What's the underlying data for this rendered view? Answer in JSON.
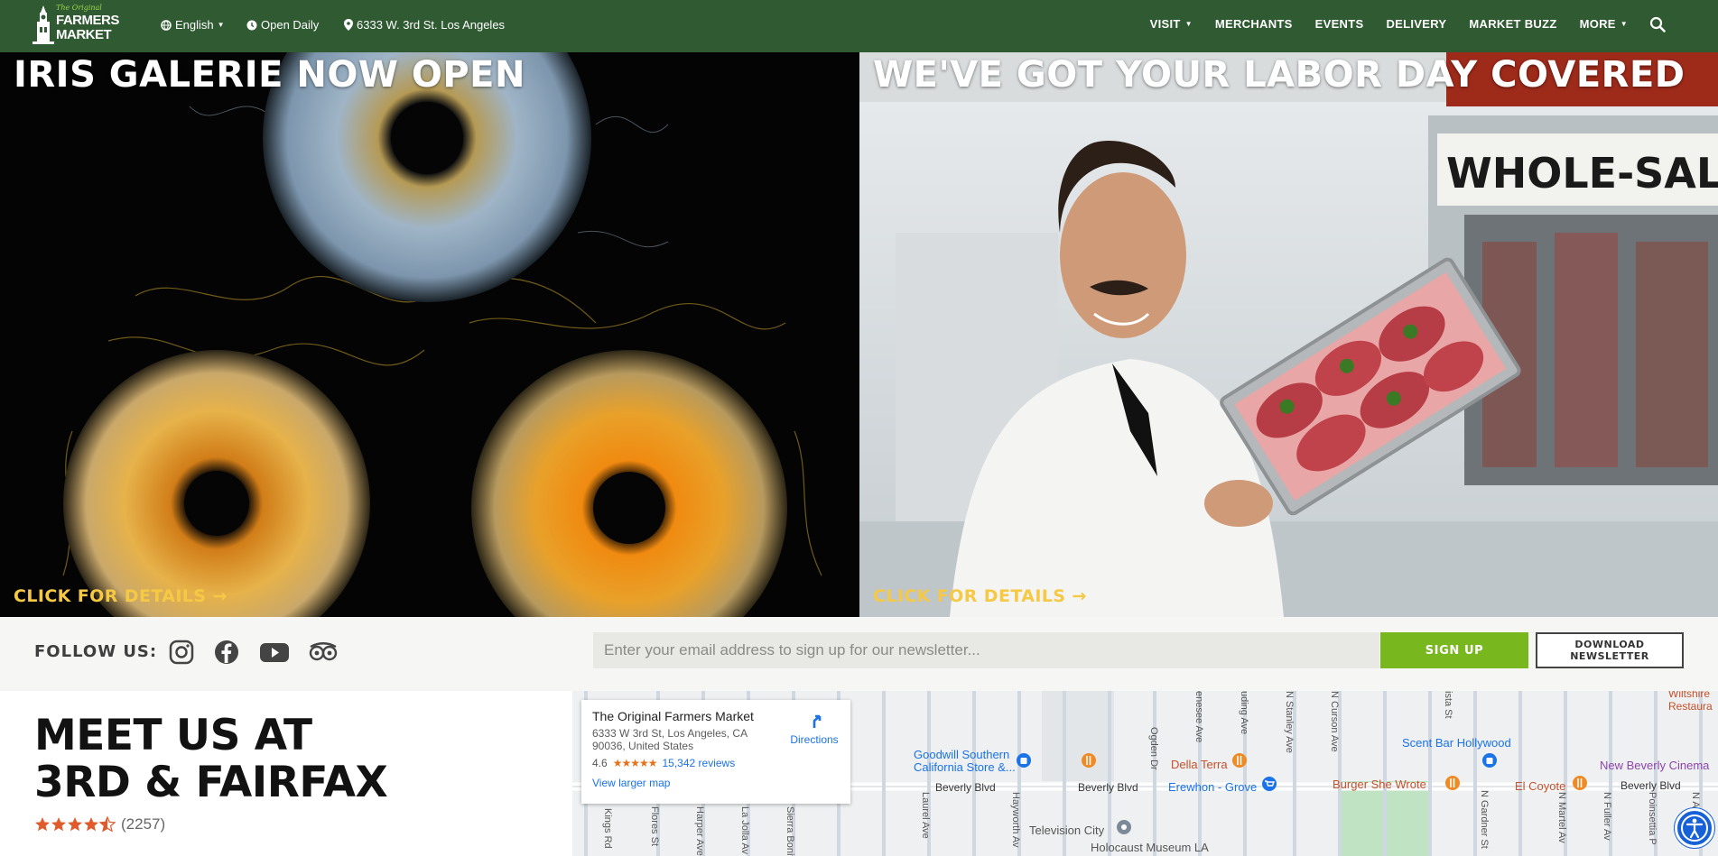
{
  "header": {
    "logo": {
      "small": "The Original",
      "line1": "FARMERS",
      "line2": "MARKET"
    },
    "language": "English",
    "hours": "Open Daily",
    "address": "6333 W. 3rd St. Los Angeles",
    "nav": [
      "VISIT",
      "MERCHANTS",
      "EVENTS",
      "DELIVERY",
      "MARKET BUZZ",
      "MORE"
    ],
    "nav_dropdowns": [
      "VISIT",
      "MORE"
    ]
  },
  "hero": {
    "left": {
      "title": "IRIS GALERIE NOW OPEN",
      "cta": "CLICK FOR DETAILS →"
    },
    "right": {
      "title": "WE'VE GOT YOUR LABOR DAY COVERED",
      "cta": "CLICK FOR DETAILS →",
      "sign": "WHOLE-SALE"
    }
  },
  "follow": {
    "label": "FOLLOW US:",
    "icons": [
      "instagram-icon",
      "facebook-icon",
      "youtube-icon",
      "tripadvisor-icon"
    ],
    "email_placeholder": "Enter your email address to sign up for our newsletter...",
    "signup_label": "SIGN UP",
    "download_line1": "DOWNLOAD",
    "download_line2": "NEWSLETTER"
  },
  "meet": {
    "line1": "MEET US AT",
    "line2": "3RD & FAIRFAX",
    "stars": 4.5,
    "count": "(2257)"
  },
  "map": {
    "card": {
      "title": "The Original Farmers Market",
      "address1": "6333 W 3rd St, Los Angeles, CA",
      "address2": "90036, United States",
      "rating": "4.6",
      "stars": "★★★★★",
      "reviews": "15,342 reviews",
      "larger": "View larger map",
      "directions": "Directions"
    },
    "places": {
      "goodwill1": "Goodwill Southern",
      "goodwill2": "California Store &...",
      "dellaterra": "Della Terra",
      "erewhon": "Erewhon - Grove",
      "burger": "Burger She Wrote",
      "elcoyote": "El Coyote",
      "scentbar": "Scent Bar Hollywood",
      "beverly_cinema": "New Beverly Cinema",
      "wiltshire": "Wiltshire",
      "restaura": "Restaura",
      "television": "Television City",
      "holocaust": "Holocaust Museum LA"
    },
    "streets": {
      "beverly1": "Beverly Blvd",
      "beverly2": "Beverly Blvd",
      "beverly3": "Beverly Blvd",
      "ogden": "Ogden Dr",
      "genesee": "enesee Ave",
      "spaulding": "uding Ave",
      "stanley": "N Stanley Ave",
      "curson": "N Curson Ave",
      "vista": "ista St",
      "gardner": "N Gardner St",
      "martel": "N Martel Av",
      "fuller": "N Fuller Av",
      "poinsettia": "Poinsettia P",
      "altavista": "N Alta Vista",
      "kings": "Kings Rd",
      "flores": "Flores St",
      "harper": "Harper Ave",
      "lajolla": "La Jolla Av",
      "sierra": "Sierra Bonita",
      "laurel": "Laurel Ave",
      "hayworth": "Hayworth Av"
    }
  },
  "colors": {
    "header_bg": "#2f5a32",
    "cta_yellow": "#f6c945",
    "signup_green": "#78b81e",
    "star_orange": "#e05a2c"
  }
}
